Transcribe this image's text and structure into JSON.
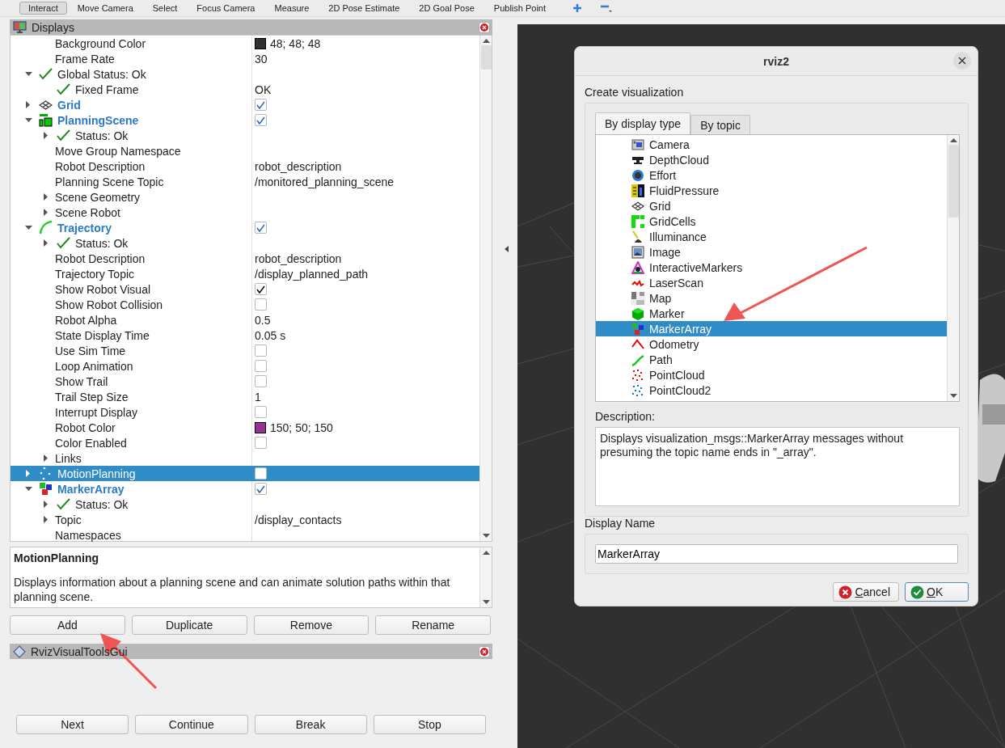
{
  "toolbar": [
    {
      "label": "Interact",
      "selected": true
    },
    {
      "label": "Move Camera",
      "selected": false
    },
    {
      "label": "Select",
      "selected": false
    },
    {
      "label": "Focus Camera",
      "selected": false
    },
    {
      "label": "Measure",
      "selected": false
    },
    {
      "label": "2D Pose Estimate",
      "selected": false
    },
    {
      "label": "2D Goal Pose",
      "selected": false
    },
    {
      "label": "Publish Point",
      "selected": false
    }
  ],
  "displays_panel": {
    "title": "Displays",
    "tree": [
      {
        "kind": "property",
        "label": "Background Color",
        "value": "48; 48; 48",
        "swatch": true,
        "selected": false
      },
      {
        "kind": "property",
        "label": "Frame Rate",
        "value": "30",
        "selected": false
      },
      {
        "kind": "status",
        "label": "Global Status: Ok",
        "expanded": true,
        "selected": false,
        "children": [
          {
            "kind": "status",
            "label": "Fixed Frame",
            "value": "OK",
            "selected": false
          }
        ]
      },
      {
        "kind": "display",
        "label": "Grid",
        "expanded": false,
        "checked": true,
        "selected": false
      },
      {
        "kind": "display",
        "label": "PlanningScene",
        "expanded": true,
        "checked": true,
        "selected": false,
        "children": [
          {
            "kind": "status",
            "label": "Status: Ok",
            "expanded": false,
            "selected": false
          },
          {
            "kind": "property",
            "label": "Move Group Namespace",
            "selected": false
          },
          {
            "kind": "property",
            "label": "Robot Description",
            "value": "robot_description",
            "selected": false
          },
          {
            "kind": "property",
            "label": "Planning Scene Topic",
            "value": "/monitored_planning_scene",
            "selected": false
          },
          {
            "kind": "property",
            "label": "Scene Geometry",
            "expanded": false,
            "selected": false
          },
          {
            "kind": "property",
            "label": "Scene Robot",
            "expanded": false,
            "selected": false
          }
        ]
      },
      {
        "kind": "display",
        "label": "Trajectory",
        "expanded": true,
        "checked": true,
        "selected": false,
        "children": [
          {
            "kind": "status",
            "label": "Status: Ok",
            "expanded": false,
            "selected": false
          },
          {
            "kind": "property",
            "label": "Robot Description",
            "value": "robot_description",
            "selected": false
          },
          {
            "kind": "property",
            "label": "Trajectory Topic",
            "value": "/display_planned_path",
            "selected": false
          },
          {
            "kind": "property",
            "label": "Show Robot Visual",
            "checked": true,
            "selected": false
          },
          {
            "kind": "property",
            "label": "Show Robot Collision",
            "checked": false,
            "selected": false
          },
          {
            "kind": "property",
            "label": "Robot Alpha",
            "value": "0.5",
            "selected": false
          },
          {
            "kind": "property",
            "label": "State Display Time",
            "value": "0.05 s",
            "selected": false
          },
          {
            "kind": "property",
            "label": "Use Sim Time",
            "checked": false,
            "selected": false
          },
          {
            "kind": "property",
            "label": "Loop Animation",
            "checked": false,
            "selected": false
          },
          {
            "kind": "property",
            "label": "Show Trail",
            "checked": false,
            "selected": false
          },
          {
            "kind": "property",
            "label": "Trail Step Size",
            "value": "1",
            "selected": false
          },
          {
            "kind": "property",
            "label": "Interrupt Display",
            "checked": false,
            "selected": false
          },
          {
            "kind": "property",
            "label": "Robot Color",
            "value": "150; 50; 150",
            "swatch": true,
            "selected": false
          },
          {
            "kind": "property",
            "label": "Color Enabled",
            "checked": false,
            "selected": false
          },
          {
            "kind": "property",
            "label": "Links",
            "expanded": false,
            "selected": false
          }
        ]
      },
      {
        "kind": "display",
        "label": "MotionPlanning",
        "expanded": false,
        "checked": false,
        "selected": true
      },
      {
        "kind": "display",
        "label": "MarkerArray",
        "expanded": true,
        "checked": true,
        "selected": false,
        "children": [
          {
            "kind": "status",
            "label": "Status: Ok",
            "expanded": false,
            "selected": false
          },
          {
            "kind": "property",
            "label": "Topic",
            "value": "/display_contacts",
            "expanded": false,
            "selected": false
          },
          {
            "kind": "property",
            "label": "Namespaces",
            "selected": false
          }
        ]
      }
    ],
    "description": {
      "title": "MotionPlanning",
      "text": "Displays information about a planning scene and can animate solution paths within that planning scene."
    },
    "buttons": [
      "Add",
      "Duplicate",
      "Remove",
      "Rename"
    ]
  },
  "tools_panel": {
    "title": "RvizVisualToolsGui",
    "buttons": [
      "Next",
      "Continue",
      "Break",
      "Stop"
    ]
  },
  "dialog": {
    "title": "rviz2",
    "heading": "Create visualization",
    "tabs": [
      {
        "label": "By display type",
        "selected": true
      },
      {
        "label": "By topic",
        "selected": false
      }
    ],
    "items": [
      {
        "label": "Camera",
        "selected": false
      },
      {
        "label": "DepthCloud",
        "selected": false
      },
      {
        "label": "Effort",
        "selected": false
      },
      {
        "label": "FluidPressure",
        "selected": false
      },
      {
        "label": "Grid",
        "selected": false
      },
      {
        "label": "GridCells",
        "selected": false
      },
      {
        "label": "Illuminance",
        "selected": false
      },
      {
        "label": "Image",
        "selected": false
      },
      {
        "label": "InteractiveMarkers",
        "selected": false
      },
      {
        "label": "LaserScan",
        "selected": false
      },
      {
        "label": "Map",
        "selected": false
      },
      {
        "label": "Marker",
        "selected": false
      },
      {
        "label": "MarkerArray",
        "selected": true
      },
      {
        "label": "Odometry",
        "selected": false
      },
      {
        "label": "Path",
        "selected": false
      },
      {
        "label": "PointCloud",
        "selected": false
      },
      {
        "label": "PointCloud2",
        "selected": false
      }
    ],
    "description_label": "Description:",
    "description": "Displays visualization_msgs::MarkerArray messages without presuming the topic name ends in \"_array\".",
    "name_label": "Display Name",
    "name_value": "MarkerArray",
    "buttons": [
      {
        "kind": "cancel",
        "label": "Cancel"
      },
      {
        "kind": "ok",
        "label": "OK"
      }
    ]
  }
}
